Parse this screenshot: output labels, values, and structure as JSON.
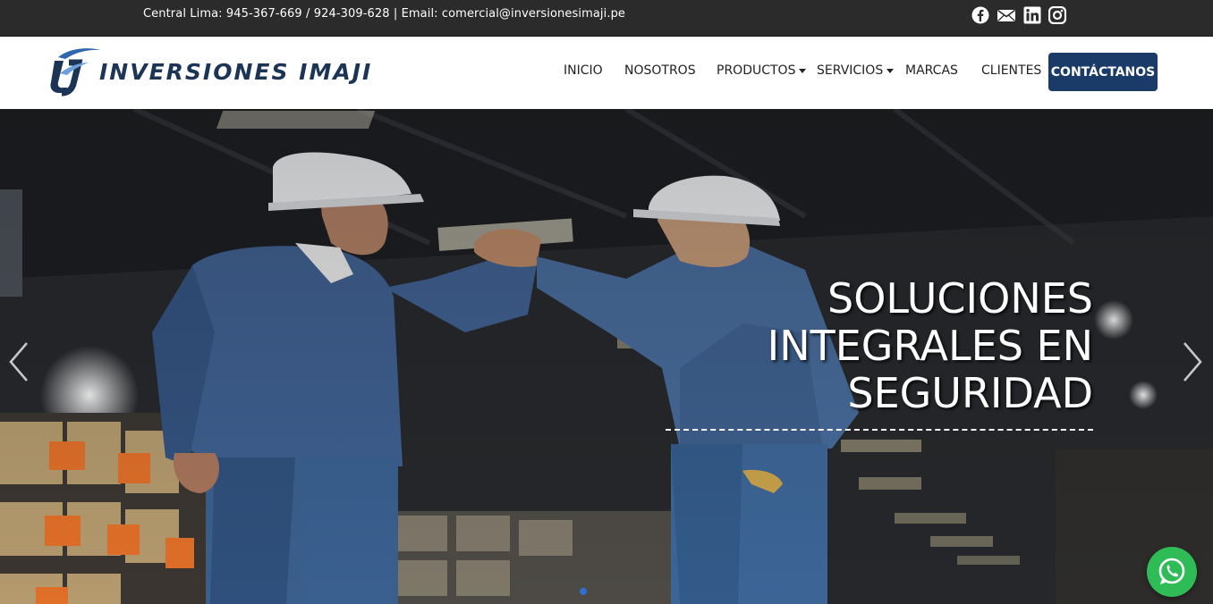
{
  "topbar": {
    "contact_text": "Central Lima: 945-367-669 / 924-309-628 | Email: comercial@inversionesimaji.pe",
    "social_icons": [
      "facebook-icon",
      "mail-icon",
      "linkedin-icon",
      "instagram-icon"
    ]
  },
  "header": {
    "logo_text": "INVERSIONES IMAJI",
    "nav": {
      "inicio": "INICIO",
      "nosotros": "NOSOTROS",
      "productos": "PRODUCTOS",
      "servicios": "SERVICIOS",
      "marcas": "MARCAS",
      "clientes": "CLIENTES"
    },
    "cta_label": "CONTÁCTANOS"
  },
  "hero": {
    "title_lines": [
      "SOLUCIONES",
      "INTEGRALES EN",
      "SEGURIDAD"
    ]
  },
  "colors": {
    "topbar_bg": "#2b2b2b",
    "brand_navy": "#1a3a68",
    "whatsapp_green": "#2fbb56"
  }
}
